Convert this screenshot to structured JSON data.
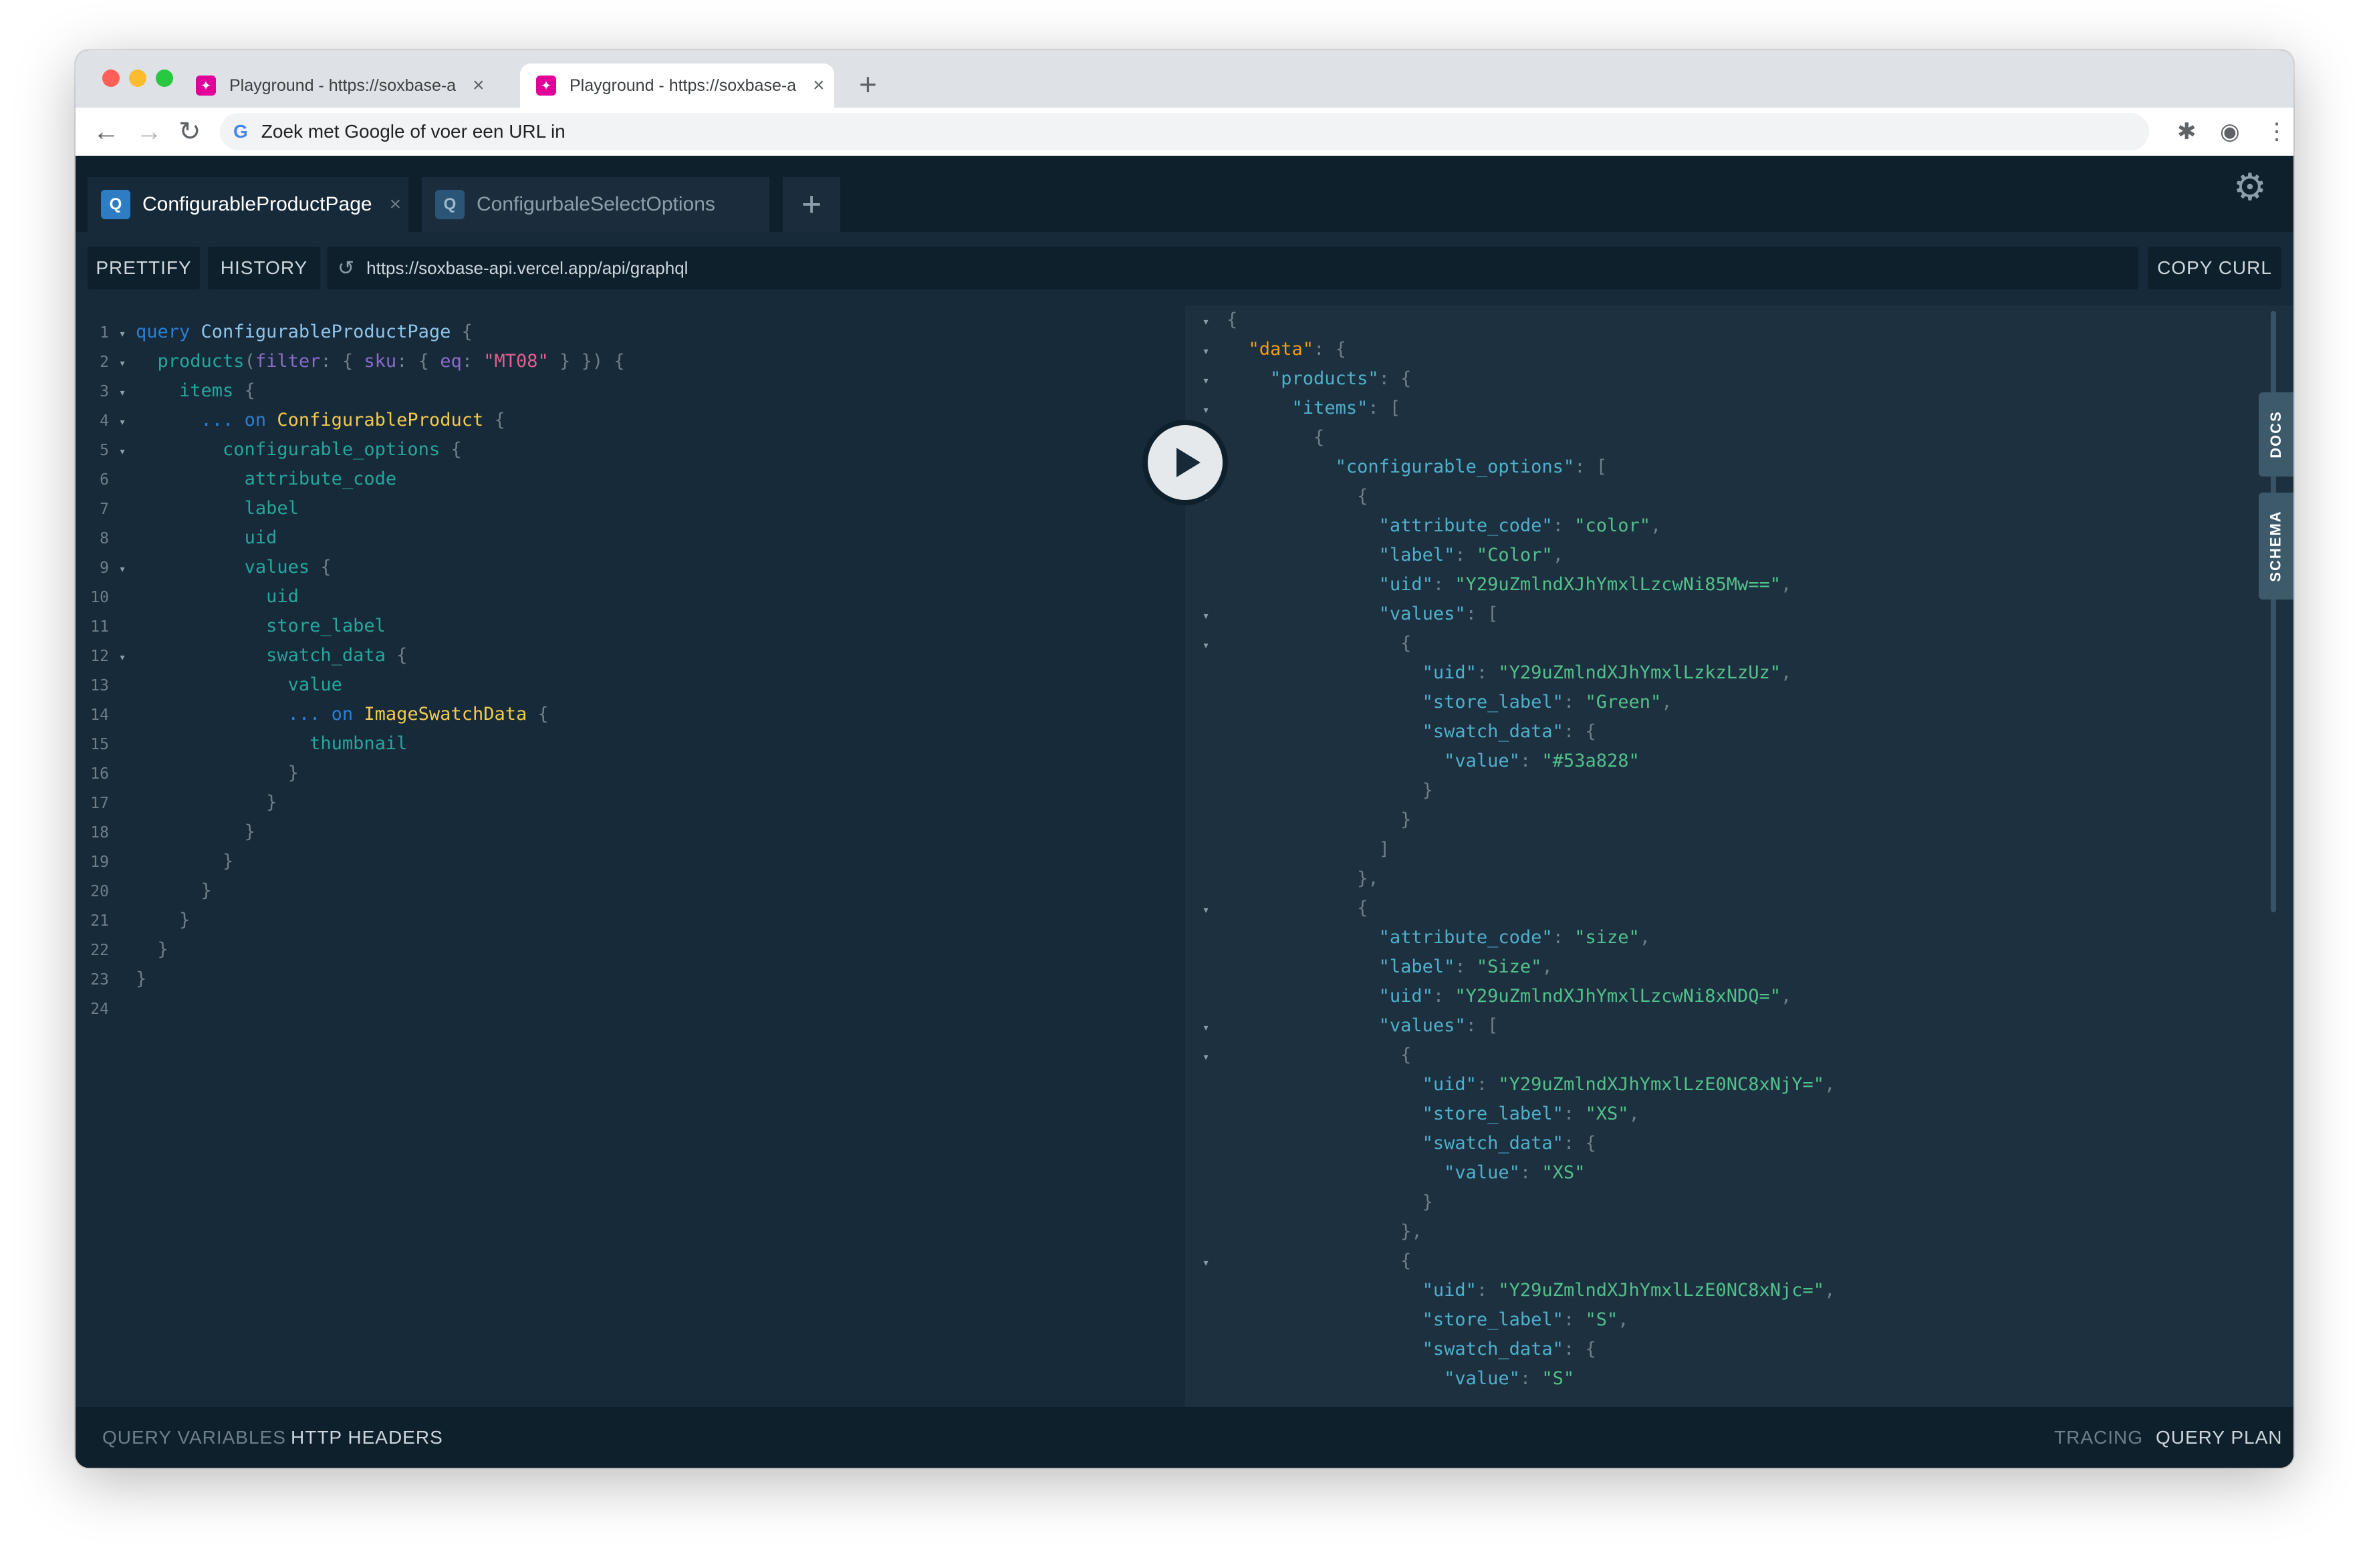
{
  "browser": {
    "tabs": [
      {
        "title": "Playground - https://soxbase-a",
        "active": false
      },
      {
        "title": "Playground - https://soxbase-a",
        "active": true
      }
    ],
    "omnibox_placeholder": "Zoek met Google of voer een URL in",
    "new_tab_symbol": "+",
    "close_symbol": "×"
  },
  "playground": {
    "query_tabs": [
      {
        "badge": "Q",
        "label": "ConfigurableProductPage",
        "close": "×"
      },
      {
        "badge": "Q",
        "label": "ConfigurbaleSelectOptions"
      }
    ],
    "add_tab": "+",
    "toolbar": {
      "prettify": "PRETTIFY",
      "history": "HISTORY",
      "endpoint": "https://soxbase-api.vercel.app/api/graphql",
      "copy_curl": "COPY CURL"
    },
    "side_tabs": {
      "docs": "DOCS",
      "schema": "SCHEMA"
    },
    "bottom": {
      "query_variables": "QUERY VARIABLES",
      "http_headers": "HTTP HEADERS",
      "tracing": "TRACING",
      "query_plan": "QUERY PLAN"
    },
    "editor_lines": [
      {
        "n": "1",
        "fold": true,
        "indent": 0,
        "tokens": [
          [
            "k",
            "query"
          ],
          [
            "p",
            " "
          ],
          [
            "d",
            "ConfigurableProductPage"
          ],
          [
            "p",
            " {"
          ]
        ]
      },
      {
        "n": "2",
        "fold": true,
        "indent": 1,
        "tokens": [
          [
            "f",
            "products"
          ],
          [
            "p",
            "("
          ],
          [
            "a",
            "filter"
          ],
          [
            "p",
            ": { "
          ],
          [
            "a",
            "sku"
          ],
          [
            "p",
            ": { "
          ],
          [
            "a",
            "eq"
          ],
          [
            "p",
            ": "
          ],
          [
            "s",
            "\"MT08\""
          ],
          [
            "p",
            " } }) {"
          ]
        ]
      },
      {
        "n": "3",
        "fold": true,
        "indent": 2,
        "tokens": [
          [
            "f",
            "items"
          ],
          [
            "p",
            " {"
          ]
        ]
      },
      {
        "n": "4",
        "fold": true,
        "indent": 3,
        "tokens": [
          [
            "k",
            "... on"
          ],
          [
            "p",
            " "
          ],
          [
            "ty",
            "ConfigurableProduct"
          ],
          [
            "p",
            " {"
          ]
        ]
      },
      {
        "n": "5",
        "fold": true,
        "indent": 4,
        "tokens": [
          [
            "f",
            "configurable_options"
          ],
          [
            "p",
            " {"
          ]
        ]
      },
      {
        "n": "6",
        "fold": false,
        "indent": 5,
        "tokens": [
          [
            "f",
            "attribute_code"
          ]
        ]
      },
      {
        "n": "7",
        "fold": false,
        "indent": 5,
        "tokens": [
          [
            "f",
            "label"
          ]
        ]
      },
      {
        "n": "8",
        "fold": false,
        "indent": 5,
        "tokens": [
          [
            "f",
            "uid"
          ]
        ]
      },
      {
        "n": "9",
        "fold": true,
        "indent": 5,
        "tokens": [
          [
            "f",
            "values"
          ],
          [
            "p",
            " {"
          ]
        ]
      },
      {
        "n": "10",
        "fold": false,
        "indent": 6,
        "tokens": [
          [
            "f",
            "uid"
          ]
        ]
      },
      {
        "n": "11",
        "fold": false,
        "indent": 6,
        "tokens": [
          [
            "f",
            "store_label"
          ]
        ]
      },
      {
        "n": "12",
        "fold": true,
        "indent": 6,
        "tokens": [
          [
            "f",
            "swatch_data"
          ],
          [
            "p",
            " {"
          ]
        ]
      },
      {
        "n": "13",
        "fold": false,
        "indent": 7,
        "tokens": [
          [
            "f",
            "value"
          ]
        ]
      },
      {
        "n": "14",
        "fold": false,
        "indent": 7,
        "tokens": [
          [
            "k",
            "... on"
          ],
          [
            "p",
            " "
          ],
          [
            "ty",
            "ImageSwatchData"
          ],
          [
            "p",
            " {"
          ]
        ]
      },
      {
        "n": "15",
        "fold": false,
        "indent": 8,
        "tokens": [
          [
            "f",
            "thumbnail"
          ]
        ]
      },
      {
        "n": "16",
        "fold": false,
        "indent": 7,
        "tokens": [
          [
            "p",
            "}"
          ]
        ]
      },
      {
        "n": "17",
        "fold": false,
        "indent": 6,
        "tokens": [
          [
            "p",
            "}"
          ]
        ]
      },
      {
        "n": "18",
        "fold": false,
        "indent": 5,
        "tokens": [
          [
            "p",
            "}"
          ]
        ]
      },
      {
        "n": "19",
        "fold": false,
        "indent": 4,
        "tokens": [
          [
            "p",
            "}"
          ]
        ]
      },
      {
        "n": "20",
        "fold": false,
        "indent": 3,
        "tokens": [
          [
            "p",
            "}"
          ]
        ]
      },
      {
        "n": "21",
        "fold": false,
        "indent": 2,
        "tokens": [
          [
            "p",
            "}"
          ]
        ]
      },
      {
        "n": "22",
        "fold": false,
        "indent": 1,
        "tokens": [
          [
            "p",
            "}"
          ]
        ]
      },
      {
        "n": "23",
        "fold": false,
        "indent": 0,
        "tokens": [
          [
            "p",
            "}"
          ]
        ]
      },
      {
        "n": "24",
        "fold": false,
        "indent": 0,
        "tokens": []
      }
    ],
    "result_lines": [
      {
        "fold": true,
        "indent": 0,
        "tokens": [
          [
            "rp",
            "{"
          ]
        ]
      },
      {
        "fold": true,
        "indent": 1,
        "tokens": [
          [
            "rd",
            "\"data\""
          ],
          [
            "rp",
            ": {"
          ]
        ]
      },
      {
        "fold": true,
        "indent": 2,
        "tokens": [
          [
            "rk",
            "\"products\""
          ],
          [
            "rp",
            ": {"
          ]
        ]
      },
      {
        "fold": true,
        "indent": 3,
        "tokens": [
          [
            "rk",
            "\"items\""
          ],
          [
            "rp",
            ": ["
          ]
        ]
      },
      {
        "fold": true,
        "indent": 4,
        "tokens": [
          [
            "rp",
            "{"
          ]
        ]
      },
      {
        "fold": true,
        "indent": 5,
        "tokens": [
          [
            "rk",
            "\"configurable_options\""
          ],
          [
            "rp",
            ": ["
          ]
        ]
      },
      {
        "fold": true,
        "indent": 6,
        "tokens": [
          [
            "rp",
            "{"
          ]
        ]
      },
      {
        "fold": false,
        "indent": 7,
        "tokens": [
          [
            "rk",
            "\"attribute_code\""
          ],
          [
            "rp",
            ": "
          ],
          [
            "rs",
            "\"color\""
          ],
          [
            "rp",
            ","
          ]
        ]
      },
      {
        "fold": false,
        "indent": 7,
        "tokens": [
          [
            "rk",
            "\"label\""
          ],
          [
            "rp",
            ": "
          ],
          [
            "rs",
            "\"Color\""
          ],
          [
            "rp",
            ","
          ]
        ]
      },
      {
        "fold": false,
        "indent": 7,
        "tokens": [
          [
            "rk",
            "\"uid\""
          ],
          [
            "rp",
            ": "
          ],
          [
            "rs",
            "\"Y29uZmlndXJhYmxlLzcwNi85Mw==\""
          ],
          [
            "rp",
            ","
          ]
        ]
      },
      {
        "fold": true,
        "indent": 7,
        "tokens": [
          [
            "rk",
            "\"values\""
          ],
          [
            "rp",
            ": ["
          ]
        ]
      },
      {
        "fold": true,
        "indent": 8,
        "tokens": [
          [
            "rp",
            "{"
          ]
        ]
      },
      {
        "fold": false,
        "indent": 9,
        "tokens": [
          [
            "rk",
            "\"uid\""
          ],
          [
            "rp",
            ": "
          ],
          [
            "rs",
            "\"Y29uZmlndXJhYmxlLzkzLzUz\""
          ],
          [
            "rp",
            ","
          ]
        ]
      },
      {
        "fold": false,
        "indent": 9,
        "tokens": [
          [
            "rk",
            "\"store_label\""
          ],
          [
            "rp",
            ": "
          ],
          [
            "rs",
            "\"Green\""
          ],
          [
            "rp",
            ","
          ]
        ]
      },
      {
        "fold": false,
        "indent": 9,
        "tokens": [
          [
            "rk",
            "\"swatch_data\""
          ],
          [
            "rp",
            ": {"
          ]
        ]
      },
      {
        "fold": false,
        "indent": 10,
        "tokens": [
          [
            "rk",
            "\"value\""
          ],
          [
            "rp",
            ": "
          ],
          [
            "rs",
            "\"#53a828\""
          ]
        ]
      },
      {
        "fold": false,
        "indent": 9,
        "tokens": [
          [
            "rp",
            "}"
          ]
        ]
      },
      {
        "fold": false,
        "indent": 8,
        "tokens": [
          [
            "rp",
            "}"
          ]
        ]
      },
      {
        "fold": false,
        "indent": 7,
        "tokens": [
          [
            "rp",
            "]"
          ]
        ]
      },
      {
        "fold": false,
        "indent": 6,
        "tokens": [
          [
            "rp",
            "},"
          ]
        ]
      },
      {
        "fold": true,
        "indent": 6,
        "tokens": [
          [
            "rp",
            "{"
          ]
        ]
      },
      {
        "fold": false,
        "indent": 7,
        "tokens": [
          [
            "rk",
            "\"attribute_code\""
          ],
          [
            "rp",
            ": "
          ],
          [
            "rs",
            "\"size\""
          ],
          [
            "rp",
            ","
          ]
        ]
      },
      {
        "fold": false,
        "indent": 7,
        "tokens": [
          [
            "rk",
            "\"label\""
          ],
          [
            "rp",
            ": "
          ],
          [
            "rs",
            "\"Size\""
          ],
          [
            "rp",
            ","
          ]
        ]
      },
      {
        "fold": false,
        "indent": 7,
        "tokens": [
          [
            "rk",
            "\"uid\""
          ],
          [
            "rp",
            ": "
          ],
          [
            "rs",
            "\"Y29uZmlndXJhYmxlLzcwNi8xNDQ=\""
          ],
          [
            "rp",
            ","
          ]
        ]
      },
      {
        "fold": true,
        "indent": 7,
        "tokens": [
          [
            "rk",
            "\"values\""
          ],
          [
            "rp",
            ": ["
          ]
        ]
      },
      {
        "fold": true,
        "indent": 8,
        "tokens": [
          [
            "rp",
            "{"
          ]
        ]
      },
      {
        "fold": false,
        "indent": 9,
        "tokens": [
          [
            "rk",
            "\"uid\""
          ],
          [
            "rp",
            ": "
          ],
          [
            "rs",
            "\"Y29uZmlndXJhYmxlLzE0NC8xNjY=\""
          ],
          [
            "rp",
            ","
          ]
        ]
      },
      {
        "fold": false,
        "indent": 9,
        "tokens": [
          [
            "rk",
            "\"store_label\""
          ],
          [
            "rp",
            ": "
          ],
          [
            "rs",
            "\"XS\""
          ],
          [
            "rp",
            ","
          ]
        ]
      },
      {
        "fold": false,
        "indent": 9,
        "tokens": [
          [
            "rk",
            "\"swatch_data\""
          ],
          [
            "rp",
            ": {"
          ]
        ]
      },
      {
        "fold": false,
        "indent": 10,
        "tokens": [
          [
            "rk",
            "\"value\""
          ],
          [
            "rp",
            ": "
          ],
          [
            "rs",
            "\"XS\""
          ]
        ]
      },
      {
        "fold": false,
        "indent": 9,
        "tokens": [
          [
            "rp",
            "}"
          ]
        ]
      },
      {
        "fold": false,
        "indent": 8,
        "tokens": [
          [
            "rp",
            "},"
          ]
        ]
      },
      {
        "fold": true,
        "indent": 8,
        "tokens": [
          [
            "rp",
            "{"
          ]
        ]
      },
      {
        "fold": false,
        "indent": 9,
        "tokens": [
          [
            "rk",
            "\"uid\""
          ],
          [
            "rp",
            ": "
          ],
          [
            "rs",
            "\"Y29uZmlndXJhYmxlLzE0NC8xNjc=\""
          ],
          [
            "rp",
            ","
          ]
        ]
      },
      {
        "fold": false,
        "indent": 9,
        "tokens": [
          [
            "rk",
            "\"store_label\""
          ],
          [
            "rp",
            ": "
          ],
          [
            "rs",
            "\"S\""
          ],
          [
            "rp",
            ","
          ]
        ]
      },
      {
        "fold": false,
        "indent": 9,
        "tokens": [
          [
            "rk",
            "\"swatch_data\""
          ],
          [
            "rp",
            ": {"
          ]
        ]
      },
      {
        "fold": false,
        "indent": 10,
        "tokens": [
          [
            "rk",
            "\"value\""
          ],
          [
            "rp",
            ": "
          ],
          [
            "rs",
            "\"S\""
          ]
        ]
      }
    ]
  },
  "colors": {
    "playground_bg": "#172a3a",
    "header_bg": "#0f202d",
    "graphql_pink": "#e10098",
    "query_badge": "#2e7cc1"
  }
}
